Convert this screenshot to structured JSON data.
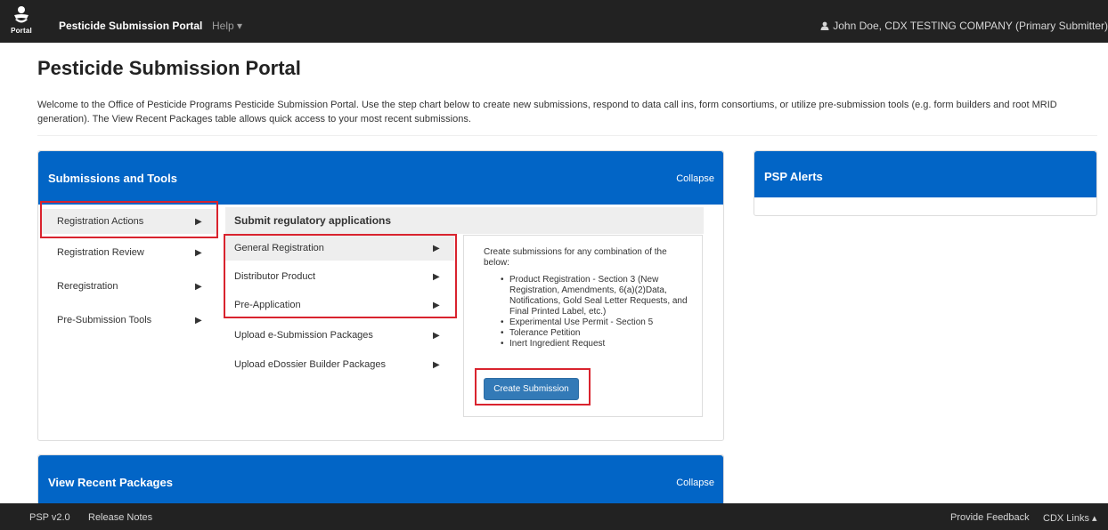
{
  "navbar": {
    "logo_text": "Portal",
    "brand": "Pesticide Submission Portal",
    "help": "Help ▾",
    "user": "John Doe, CDX TESTING COMPANY (Primary Submitter)"
  },
  "page": {
    "title": "Pesticide Submission Portal",
    "intro": "Welcome to the Office of Pesticide Programs Pesticide Submission Portal. Use the step chart below to create new submissions, respond to data call ins, form consortiums, or utilize pre-submission tools (e.g. form builders and root MRID generation). The View Recent Packages table allows quick access to your most recent submissions."
  },
  "tools_panel": {
    "title": "Submissions and Tools",
    "collapse": "Collapse",
    "steps": [
      {
        "label": "Registration Actions",
        "arrow": "▶"
      },
      {
        "label": "Registration Review",
        "arrow": "▶"
      },
      {
        "label": "Reregistration",
        "arrow": "▶"
      },
      {
        "label": "Pre-Submission Tools",
        "arrow": "▶"
      }
    ],
    "sub_heading": "Submit regulatory applications",
    "sub_steps": [
      {
        "label": "General Registration",
        "arrow": "▶"
      },
      {
        "label": "Distributor Product",
        "arrow": "▶"
      },
      {
        "label": "Pre-Application",
        "arrow": "▶"
      },
      {
        "label": "Upload e-Submission Packages",
        "arrow": "▶"
      },
      {
        "label": "Upload eDossier Builder Packages",
        "arrow": "▶"
      }
    ],
    "description": {
      "intro": "Create submissions for any combination of the below:",
      "items": [
        "Product Registration - Section 3 (New Registration, Amendments, 6(a)(2)Data, Notifications, Gold Seal Letter Requests, and Final Printed Label, etc.)",
        "Experimental Use Permit - Section 5",
        "Tolerance Petition",
        "Inert Ingredient Request"
      ]
    },
    "create_button": "Create Submission"
  },
  "alerts_panel": {
    "title": "PSP Alerts"
  },
  "recent_panel": {
    "title": "View Recent Packages",
    "collapse": "Collapse"
  },
  "footer": {
    "version": "PSP v2.0",
    "release_notes": "Release Notes",
    "feedback": "Provide Feedback",
    "cdx_links": "CDX Links ▴"
  },
  "colors": {
    "navbar": "#222222",
    "panel_header": "#0265c6",
    "highlight": "#d9232e",
    "button": "#337ab7"
  }
}
